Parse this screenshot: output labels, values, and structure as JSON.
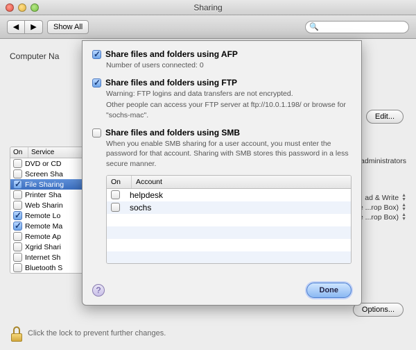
{
  "window": {
    "title": "Sharing"
  },
  "toolbar": {
    "show_all": "Show All",
    "back": "◀",
    "forward": "▶"
  },
  "search": {
    "placeholder": ""
  },
  "computer_name_label": "Computer Na",
  "edit_button": "Edit...",
  "options_button": "Options...",
  "lock_text": "Click the lock to prevent further changes.",
  "services": {
    "headers": [
      "On",
      "Service"
    ],
    "rows": [
      {
        "on": false,
        "name": "DVD or CD"
      },
      {
        "on": false,
        "name": "Screen Sha"
      },
      {
        "on": true,
        "name": "File Sharing",
        "selected": true
      },
      {
        "on": false,
        "name": "Printer Sha"
      },
      {
        "on": false,
        "name": "Web Sharin"
      },
      {
        "on": true,
        "name": "Remote Lo"
      },
      {
        "on": true,
        "name": "Remote Ma"
      },
      {
        "on": false,
        "name": "Remote Ap"
      },
      {
        "on": false,
        "name": "Xgrid Shari"
      },
      {
        "on": false,
        "name": "Internet Sh"
      },
      {
        "on": false,
        "name": "Bluetooth S"
      }
    ]
  },
  "right_info": {
    "line1": "and administrators",
    "perm1": "ad & Write",
    "perm2": "rite ...rop Box)",
    "perm3": "rite ...rop Box)"
  },
  "sheet": {
    "afp": {
      "on": true,
      "label": "Share files and folders using AFP",
      "sub": "Number of users connected: 0"
    },
    "ftp": {
      "on": true,
      "label": "Share files and folders using FTP",
      "warn": "Warning: FTP logins and data transfers are not encrypted.",
      "info": "Other people can access your FTP server at ftp://10.0.1.198/ or browse for \"sochs-mac\"."
    },
    "smb": {
      "on": false,
      "label": "Share files and folders using SMB",
      "info": "When you enable SMB sharing for a user account, you must enter the password for that account. Sharing with SMB stores this password in a less secure manner."
    },
    "accounts": {
      "headers": [
        "On",
        "Account"
      ],
      "rows": [
        {
          "on": false,
          "name": "helpdesk"
        },
        {
          "on": false,
          "name": "sochs"
        }
      ]
    },
    "done": "Done",
    "help": "?"
  }
}
